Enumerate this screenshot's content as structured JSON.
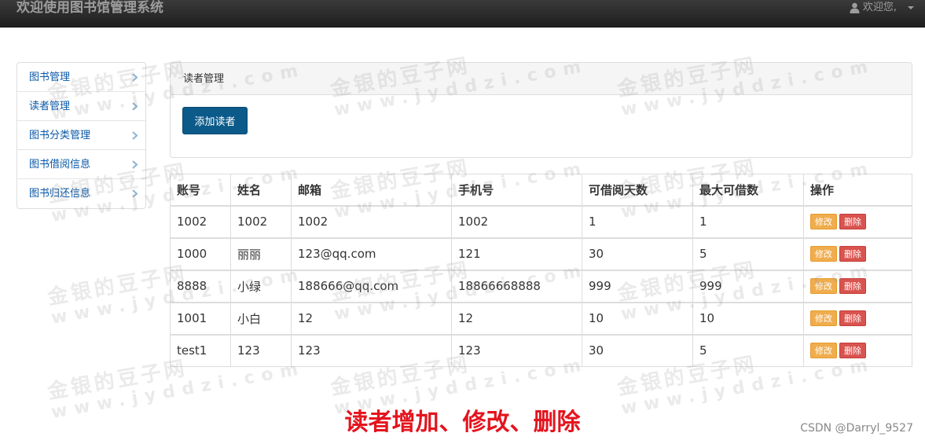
{
  "navbar": {
    "title": "欢迎使用图书馆管理系统",
    "user_greeting": "欢迎您,"
  },
  "sidebar": {
    "items": [
      {
        "label": "图书管理"
      },
      {
        "label": "读者管理"
      },
      {
        "label": "图书分类管理"
      },
      {
        "label": "图书借阅信息"
      },
      {
        "label": "图书归还信息"
      }
    ]
  },
  "panel": {
    "title": "读者管理",
    "add_button": "添加读者"
  },
  "table": {
    "headers": [
      "账号",
      "姓名",
      "邮箱",
      "手机号",
      "可借阅天数",
      "最大可借数",
      "操作"
    ],
    "rows": [
      [
        "1002",
        "1002",
        "1002",
        "1002",
        "1",
        "1"
      ],
      [
        "1000",
        "丽丽",
        "123@qq.com",
        "121",
        "30",
        "5"
      ],
      [
        "8888",
        "小绿",
        "188666@qq.com",
        "18866668888",
        "999",
        "999"
      ],
      [
        "1001",
        "小白",
        "12",
        "12",
        "10",
        "10"
      ],
      [
        "test1",
        "123",
        "123",
        "123",
        "30",
        "5"
      ]
    ],
    "edit_label": "修改",
    "delete_label": "删除"
  },
  "watermark": {
    "cn": "金银的豆子网",
    "url": "www.jyddzi.com"
  },
  "caption": "读者增加、修改、删除",
  "credit": "CSDN @Darryl_9527",
  "colors": {
    "navbar": "#222222",
    "link": "#0a58a8",
    "primary_button": "#0b5a8a",
    "edit_button": "#f0ad4e",
    "delete_button": "#d9534f",
    "caption": "#e4141e"
  }
}
